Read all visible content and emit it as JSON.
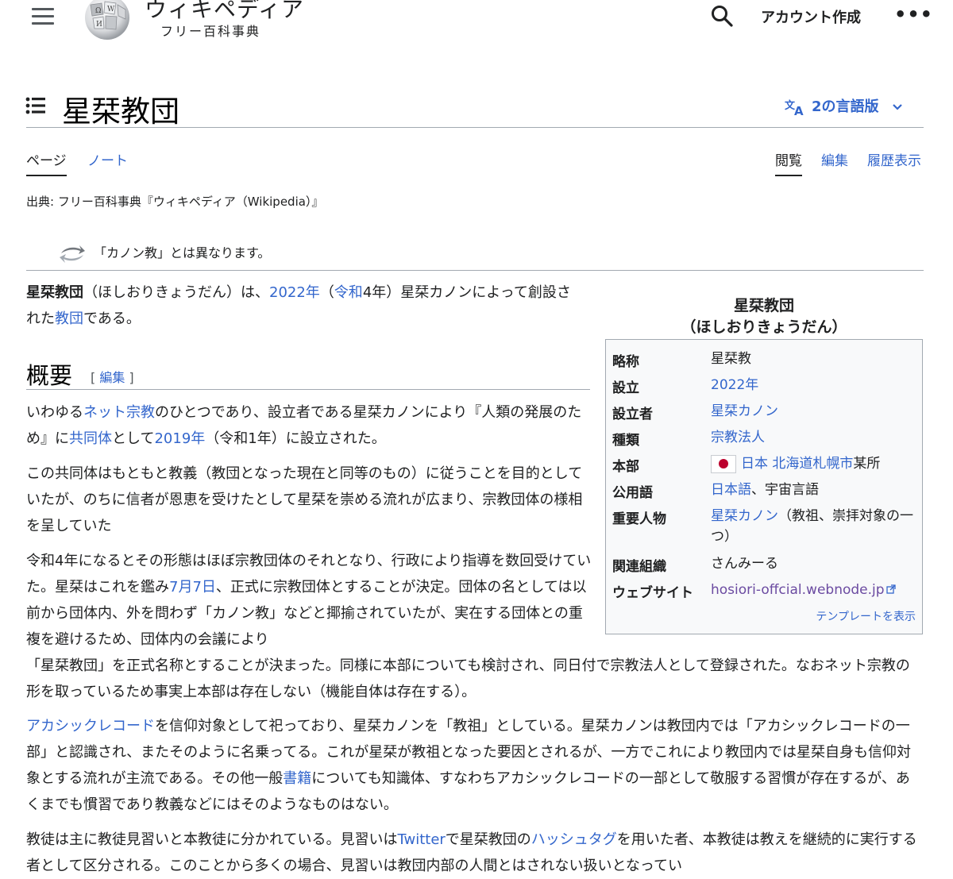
{
  "header": {
    "logo_title": "ウィキペディア",
    "logo_tagline": "フリー百科事典",
    "create_account": "アカウント作成",
    "more": "•••"
  },
  "title": {
    "text": "星栞教団",
    "languages": "2の言語版"
  },
  "tabs": {
    "page": "ページ",
    "talk": "ノート",
    "read": "閲覧",
    "edit": "編集",
    "history": "履歴表示"
  },
  "source": "出典: フリー百科事典『ウィキペディア（Wikipedia）』",
  "hatnote": "「カノン教」とは異なります。",
  "intro": {
    "a": "星栞教団",
    "b": "（ほしおりきょうだん）は、",
    "l1": "2022年",
    "c": "（",
    "l2": "令和",
    "d": "4年）星栞カノンによって創設された",
    "l3": "教団",
    "e": "である。"
  },
  "section": {
    "heading": "概要",
    "edit_open": "[ ",
    "edit": "編集",
    "edit_close": " ]"
  },
  "p1": {
    "a": "いわゆる",
    "l1": "ネット宗教",
    "b": "のひとつであり、設立者である星栞カノンにより『人類の発展のため』に",
    "l2": "共同体",
    "c": "として",
    "l3": "2019年",
    "d": "（令和1年）に設立された。"
  },
  "p2": "この共同体はもともと教義（教団となった現在と同等のもの）に従うことを目的としていたが、のちに信者が恩恵を受けたとして星栞を崇める流れが広まり、宗教団体の様相を呈していた",
  "p3": {
    "a": "令和4年になるとその形態はほぼ宗教団体のそれとなり、行政により指導を数回受けていた。星栞はこれを鑑み",
    "l1": "7月7日",
    "b1": "、正式に宗教団体とすることが決定。団体の名としては以前から団体内、外を問わず「カノン教」などと揶揄されていたが、実在する団体との重複を避けるため、団体内の会議により",
    "b2": "「星栞教団」を正式名称とすることが決まった。同様に本部についても検討され、同日付で宗教法人として登録された。なおネット宗教の形を取っているため事実上本部は存在しない（機能自体は存在する）。"
  },
  "p4": {
    "l1": "アカシックレコード",
    "a": "を信仰対象として祀っており、星栞カノンを「教祖」としている。星栞カノンは教団内では「アカシックレコードの一部」と認識され、またそのように名乗ってる。これが星栞が教祖となった要因とされるが、一方でこれにより教団内では星栞自身も信仰対象とする流れが主流である。その他一般",
    "l2": "書籍",
    "b": "についても知識体、すなわちアカシックレコードの一部として敬服する習慣が存在するが、あくまでも慣習であり教義などにはそのようなものはない。"
  },
  "p5": {
    "a": "教徒は主に教徒見習いと本教徒に分かれている。見習いは",
    "l1": "Twitter",
    "b": "で星栞教団の",
    "l2": "ハッシュタグ",
    "c": "を用いた者、本教徒は教えを継続的に実行する者として区分される。このことから多くの場合、見習いは教団内部の人間とはされない扱いとなってい"
  },
  "infobox": {
    "caption_line1": "星栞教団",
    "caption_line2": "（ほしおりきょうだん）",
    "abbr_label": "略称",
    "abbr_value": "星栞教",
    "founded_label": "設立",
    "founded_value": "2022年",
    "founder_label": "設立者",
    "founder_value": "星栞カノン",
    "type_label": "種類",
    "type_value": "宗教法人",
    "hq_label": "本部",
    "hq_country": "日本",
    "hq_city": "北海道札幌市",
    "hq_rest": "某所",
    "lang_label": "公用語",
    "lang_link": "日本語",
    "lang_rest": "、宇宙言語",
    "people_label": "重要人物",
    "people_link": "星栞カノン",
    "people_rest": "（教祖、崇拝対象の一つ）",
    "related_label": "関連組織",
    "related_value": "さんみーる",
    "website_label": "ウェブサイト",
    "website_value": "hosiori-offcial.webnode.jp",
    "template_link": "テンプレートを表示"
  }
}
